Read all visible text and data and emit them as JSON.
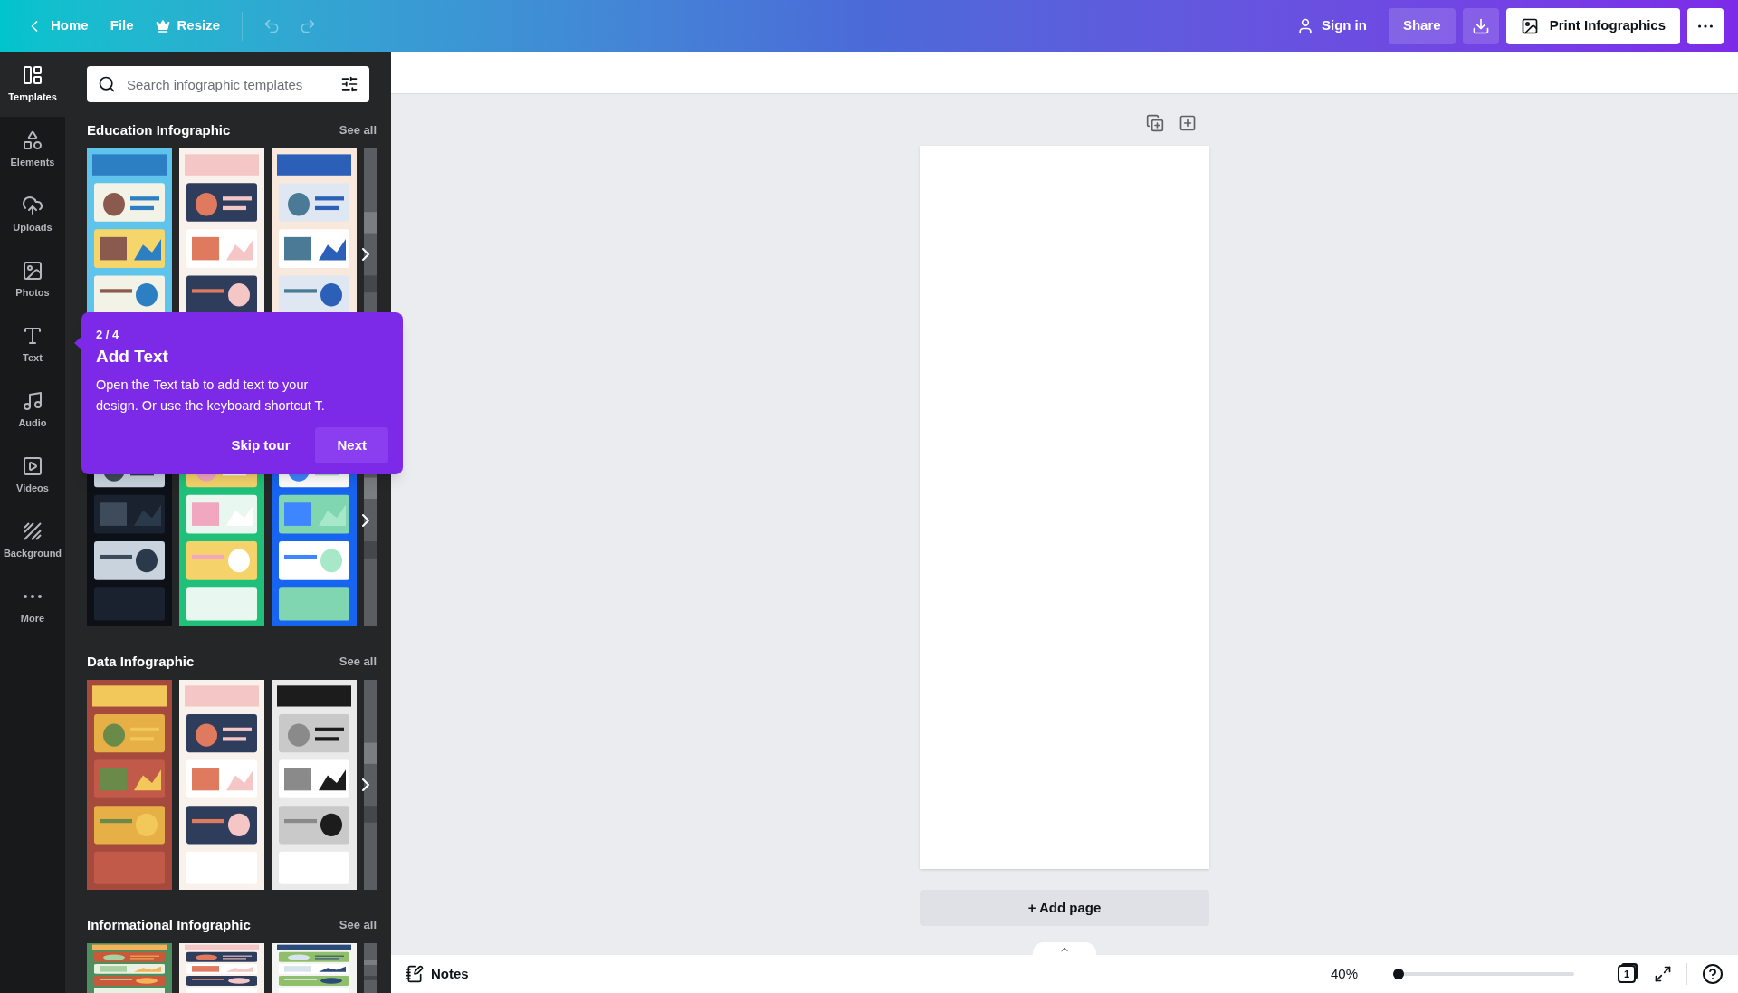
{
  "topbar": {
    "nav": [
      {
        "label": "Home",
        "kind": "back"
      },
      {
        "label": "File",
        "kind": "plain"
      },
      {
        "label": "Resize",
        "kind": "crown"
      }
    ],
    "history": [
      {
        "kind": "undo",
        "disabled": true
      },
      {
        "kind": "redo",
        "disabled": true
      }
    ],
    "sign_in": "Sign in",
    "share": "Share",
    "print": "Print Infographics"
  },
  "rail": [
    {
      "label": "Templates",
      "kind": "templates",
      "selected": true
    },
    {
      "label": "Elements",
      "kind": "elements",
      "selected": false
    },
    {
      "label": "Uploads",
      "kind": "uploads",
      "selected": false
    },
    {
      "label": "Photos",
      "kind": "photos",
      "selected": false
    },
    {
      "label": "Text",
      "kind": "text",
      "selected": false
    },
    {
      "label": "Audio",
      "kind": "audio",
      "selected": false
    },
    {
      "label": "Videos",
      "kind": "videos",
      "selected": false
    },
    {
      "label": "Background",
      "kind": "background",
      "selected": false
    },
    {
      "label": "More",
      "kind": "more",
      "selected": false
    }
  ],
  "search": {
    "placeholder": "Search infographic templates"
  },
  "sections": [
    {
      "title": "Education Infographic",
      "see_all": "See all",
      "thumbnails": [
        {
          "kind": "picture"
        },
        {
          "kind": "picture"
        },
        {
          "kind": "picture"
        }
      ]
    },
    {
      "thumbnails": [
        {
          "kind": "picture"
        },
        {
          "kind": "picture"
        },
        {
          "kind": "picture"
        }
      ]
    },
    {
      "title": "Data Infographic",
      "see_all": "See all",
      "thumbnails": [
        {
          "kind": "picture"
        },
        {
          "kind": "picture"
        },
        {
          "kind": "picture"
        }
      ]
    },
    {
      "title": "Informational Infographic",
      "see_all": "See all",
      "thumbnails": [
        {
          "kind": "picture"
        },
        {
          "kind": "picture"
        },
        {
          "kind": "picture"
        }
      ]
    }
  ],
  "tour": {
    "step": "2 / 4",
    "title": "Add Text",
    "body": "Open the Text tab to add text to your design. Or use the keyboard shortcut T.",
    "skip": "Skip tour",
    "next": "Next"
  },
  "canvas": {
    "add_page": "+ Add page"
  },
  "footer": {
    "notes": "Notes",
    "zoom": "40%",
    "zoom_slider": {
      "level": 0.03
    },
    "pages": "1"
  }
}
